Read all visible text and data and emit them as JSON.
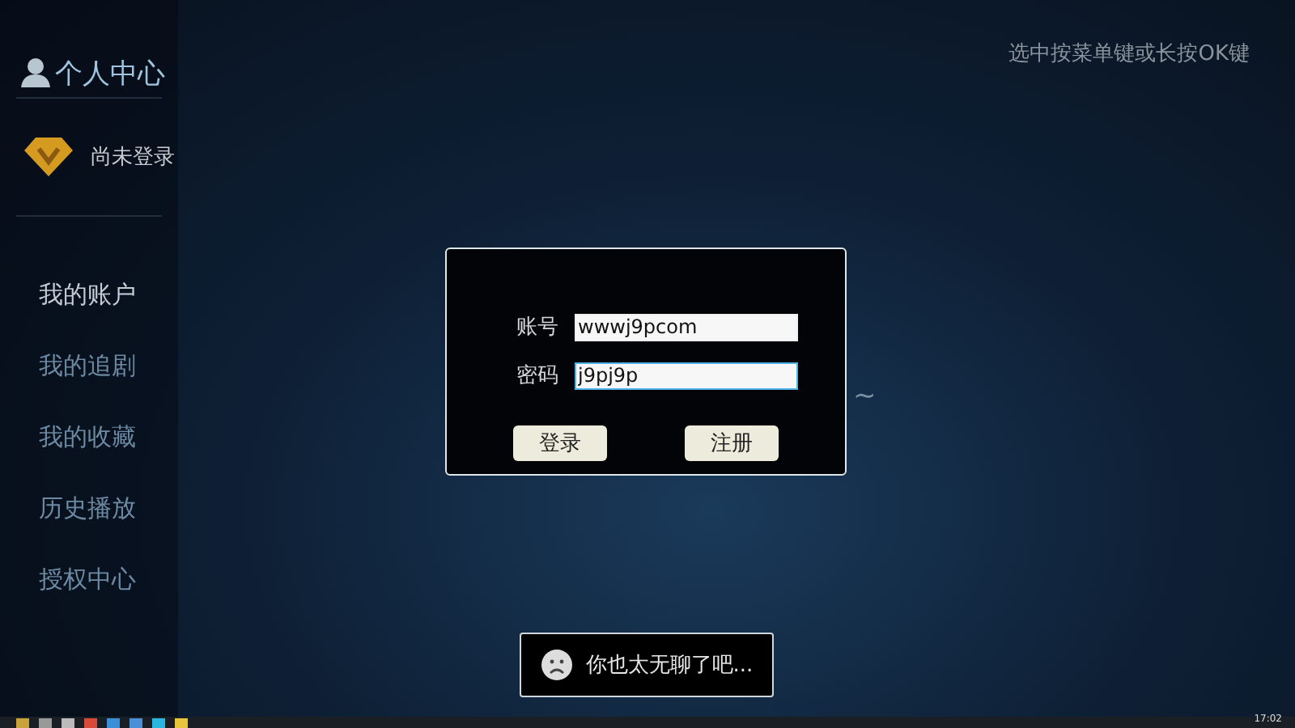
{
  "sidebar": {
    "title": "个人中心",
    "login_status": "尚未登录",
    "items": [
      {
        "label": "我的账户",
        "selected": true
      },
      {
        "label": "我的追剧",
        "selected": false
      },
      {
        "label": "我的收藏",
        "selected": false
      },
      {
        "label": "历史播放",
        "selected": false
      },
      {
        "label": "授权中心",
        "selected": false
      }
    ]
  },
  "hint": "选中按菜单键或长按OK键",
  "empty_message": "~",
  "login_dialog": {
    "fields": [
      {
        "label": "账号",
        "value": "wwwj9pcom",
        "focused": false
      },
      {
        "label": "密码",
        "value": "j9pj9p",
        "focused": true
      }
    ],
    "buttons": [
      "登录",
      "注册"
    ]
  },
  "toast": {
    "text": "你也太无聊了吧..."
  },
  "taskbar": {
    "clock": "17:02"
  }
}
